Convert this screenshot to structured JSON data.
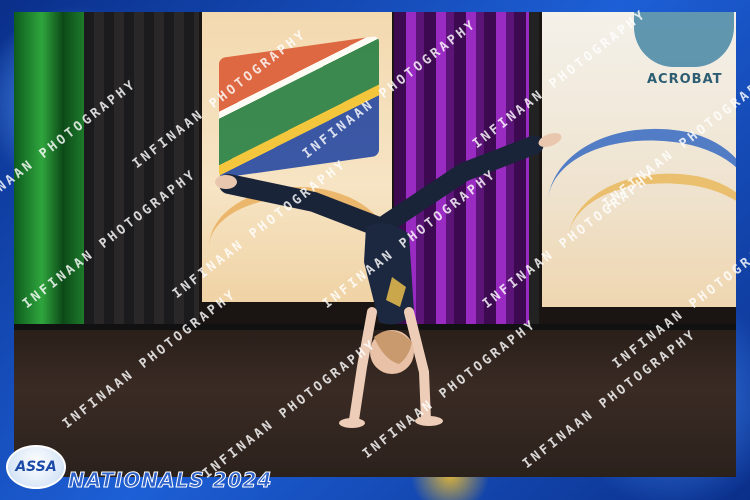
{
  "photo": {
    "subject": "gymnast",
    "banner_text": "ACROBAT"
  },
  "watermark": {
    "text": "INFINAAN PHOTOGRAPHY"
  },
  "branding": {
    "logo_text": "ASSA",
    "event_title": "NATIONALS 2024"
  },
  "colors": {
    "frame": "#0b3fa8",
    "event_title": "#2e62c9",
    "logo": "#1b4aa8"
  }
}
